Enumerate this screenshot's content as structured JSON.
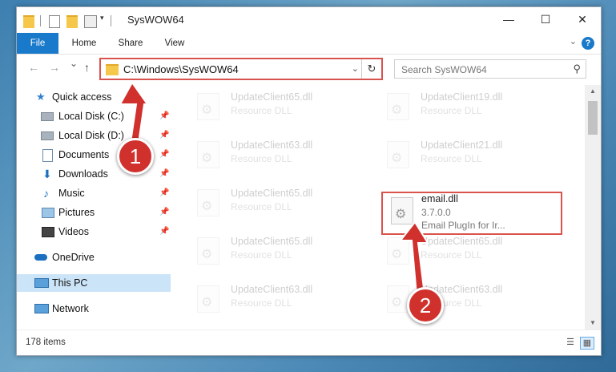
{
  "window": {
    "title": "SysWOW64"
  },
  "ribbon": {
    "tabs": [
      "File",
      "Home",
      "Share",
      "View"
    ],
    "help": "?"
  },
  "navigation": {
    "back": "←",
    "forward": "→",
    "recent": "⌄",
    "up": "↑",
    "address": "C:\\Windows\\SysWOW64",
    "search_placeholder": "Search SysWOW64"
  },
  "sidebar": {
    "items": [
      {
        "label": "Quick access",
        "icon": "star-icon",
        "pinned": false
      },
      {
        "label": "Local Disk (C:)",
        "icon": "drive-icon",
        "pinned": true
      },
      {
        "label": "Local Disk (D:)",
        "icon": "drive-icon",
        "pinned": true
      },
      {
        "label": "Documents",
        "icon": "documents-icon",
        "pinned": true
      },
      {
        "label": "Downloads",
        "icon": "download-icon",
        "pinned": true
      },
      {
        "label": "Music",
        "icon": "music-icon",
        "pinned": true
      },
      {
        "label": "Pictures",
        "icon": "pictures-icon",
        "pinned": true
      },
      {
        "label": "Videos",
        "icon": "videos-icon",
        "pinned": true
      },
      {
        "label": "OneDrive",
        "icon": "cloud-icon",
        "pinned": false
      },
      {
        "label": "This PC",
        "icon": "computer-icon",
        "pinned": false,
        "selected": true
      },
      {
        "label": "Network",
        "icon": "network-icon",
        "pinned": false
      }
    ]
  },
  "files": {
    "left_column": [
      {
        "name": "UpdateClient65.dll",
        "type": "Resource DLL"
      },
      {
        "name": "UpdateClient63.dll",
        "type": "Resource DLL"
      },
      {
        "name": "UpdateClient65.dll",
        "type": "Resource DLL"
      },
      {
        "name": "UpdateClient65.dll",
        "type": "Resource DLL"
      },
      {
        "name": "UpdateClient63.dll",
        "type": "Resource DLL"
      }
    ],
    "right_column": [
      {
        "name": "UpdateClient19.dll",
        "type": "Resource DLL"
      },
      {
        "name": "UpdateClient21.dll",
        "type": "Resource DLL"
      },
      {
        "name": "UpdateClient65.dll",
        "type": "Resource DLL"
      },
      {
        "name": "UpdateClient63.dll",
        "type": "Resource DLL"
      }
    ],
    "highlighted": {
      "name": "email.dll",
      "version": "3.7.0.0",
      "description": "Email PlugIn for Ir..."
    }
  },
  "status": {
    "item_count": "178 items"
  },
  "annotations": {
    "step1": "1",
    "step2": "2"
  },
  "colors": {
    "accent": "#1979ca",
    "highlight_red": "#d9534f",
    "badge_red": "#d0312d",
    "selected_bg": "#cce4f7"
  }
}
